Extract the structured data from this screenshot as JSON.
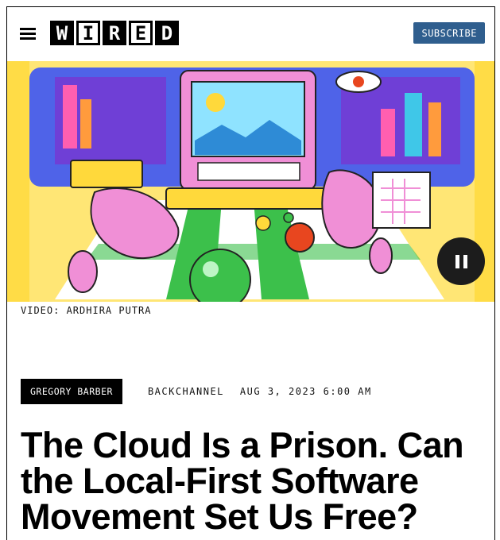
{
  "header": {
    "logo_letters": [
      "W",
      "I",
      "R",
      "E",
      "D"
    ],
    "subscribe_label": "SUBSCRIBE"
  },
  "hero": {
    "credit": "VIDEO: ARDHIRA PUTRA"
  },
  "article": {
    "author": "GREGORY BARBER",
    "rubric": "BACKCHANNEL",
    "date": "AUG 3, 2023 6:00 AM",
    "headline": "The Cloud Is a Prison. Can the Local-First Software Movement Set Us Free?"
  },
  "colors": {
    "subscribe_bg": "#2f5e8e",
    "hero_pink": "#f08fd6",
    "hero_yellow": "#ffd93b",
    "hero_green": "#3cc04b"
  },
  "icons": [
    "hamburger-menu-icon",
    "pause-icon"
  ]
}
